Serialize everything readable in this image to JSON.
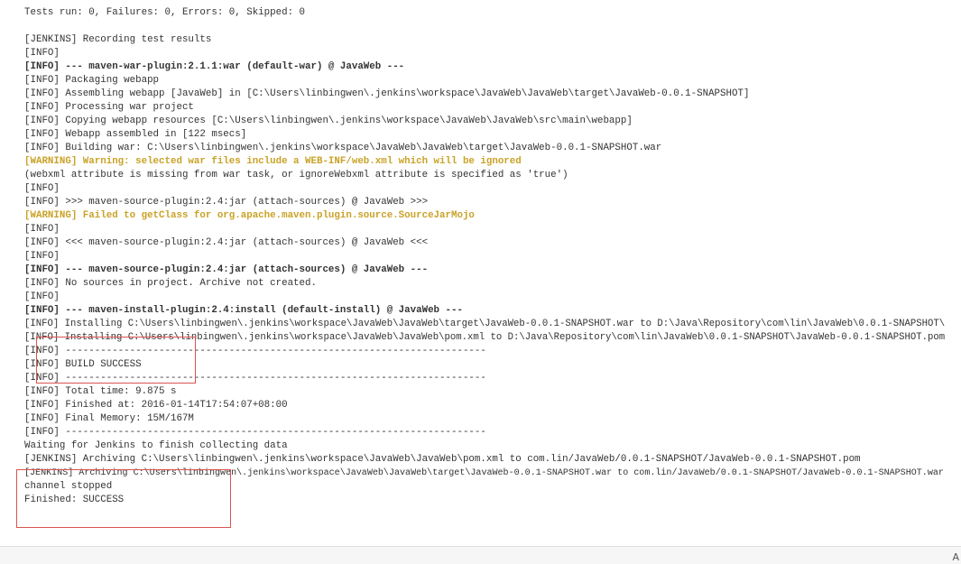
{
  "console": {
    "lines": [
      {
        "text": "Tests run: 0, Failures: 0, Errors: 0, Skipped: 0",
        "style": ""
      },
      {
        "text": "",
        "style": ""
      },
      {
        "text": "[JENKINS] Recording test results",
        "style": ""
      },
      {
        "text": "[INFO]",
        "style": ""
      },
      {
        "text": "[INFO] --- maven-war-plugin:2.1.1:war (default-war) @ JavaWeb ---",
        "style": "bold"
      },
      {
        "text": "[INFO] Packaging webapp",
        "style": ""
      },
      {
        "text": "[INFO] Assembling webapp [JavaWeb] in [C:\\Users\\linbingwen\\.jenkins\\workspace\\JavaWeb\\JavaWeb\\target\\JavaWeb-0.0.1-SNAPSHOT]",
        "style": ""
      },
      {
        "text": "[INFO] Processing war project",
        "style": ""
      },
      {
        "text": "[INFO] Copying webapp resources [C:\\Users\\linbingwen\\.jenkins\\workspace\\JavaWeb\\JavaWeb\\src\\main\\webapp]",
        "style": ""
      },
      {
        "text": "[INFO] Webapp assembled in [122 msecs]",
        "style": ""
      },
      {
        "text": "[INFO] Building war: C:\\Users\\linbingwen\\.jenkins\\workspace\\JavaWeb\\JavaWeb\\target\\JavaWeb-0.0.1-SNAPSHOT.war",
        "style": ""
      },
      {
        "text": "[WARNING] Warning: selected war files include a WEB-INF/web.xml which will be ignored",
        "style": "warn"
      },
      {
        "text": "(webxml attribute is missing from war task, or ignoreWebxml attribute is specified as 'true')",
        "style": ""
      },
      {
        "text": "[INFO]",
        "style": ""
      },
      {
        "text": "[INFO] >>> maven-source-plugin:2.4:jar (attach-sources) @ JavaWeb >>>",
        "style": ""
      },
      {
        "text": "[WARNING] Failed to getClass for org.apache.maven.plugin.source.SourceJarMojo",
        "style": "warn"
      },
      {
        "text": "[INFO]",
        "style": ""
      },
      {
        "text": "[INFO] <<< maven-source-plugin:2.4:jar (attach-sources) @ JavaWeb <<<",
        "style": ""
      },
      {
        "text": "[INFO]",
        "style": ""
      },
      {
        "text": "[INFO] --- maven-source-plugin:2.4:jar (attach-sources) @ JavaWeb ---",
        "style": "bold"
      },
      {
        "text": "[INFO] No sources in project. Archive not created.",
        "style": ""
      },
      {
        "text": "[INFO]",
        "style": ""
      },
      {
        "text": "[INFO] --- maven-install-plugin:2.4:install (default-install) @ JavaWeb ---",
        "style": "bold"
      },
      {
        "text": "[INFO] Installing C:\\Users\\linbingwen\\.jenkins\\workspace\\JavaWeb\\JavaWeb\\target\\JavaWeb-0.0.1-SNAPSHOT.war to D:\\Java\\Repository\\com\\lin\\JavaWeb\\0.0.1-SNAPSHOT\\",
        "style": ""
      },
      {
        "text": "[INFO] Installing C:\\Users\\linbingwen\\.jenkins\\workspace\\JavaWeb\\JavaWeb\\pom.xml to D:\\Java\\Repository\\com\\lin\\JavaWeb\\0.0.1-SNAPSHOT\\JavaWeb-0.0.1-SNAPSHOT.pom",
        "style": ""
      },
      {
        "text": "[INFO] ------------------------------------------------------------------------",
        "style": ""
      },
      {
        "text": "[INFO] BUILD SUCCESS",
        "style": ""
      },
      {
        "text": "[INFO] ------------------------------------------------------------------------",
        "style": ""
      },
      {
        "text": "[INFO] Total time: 9.875 s",
        "style": ""
      },
      {
        "text": "[INFO] Finished at: 2016-01-14T17:54:07+08:00",
        "style": ""
      },
      {
        "text": "[INFO] Final Memory: 15M/167M",
        "style": ""
      },
      {
        "text": "[INFO] ------------------------------------------------------------------------",
        "style": ""
      },
      {
        "text": "Waiting for Jenkins to finish collecting data",
        "style": ""
      },
      {
        "text": "[JENKINS] Archiving C:\\Users\\linbingwen\\.jenkins\\workspace\\JavaWeb\\JavaWeb\\pom.xml to com.lin/JavaWeb/0.0.1-SNAPSHOT/JavaWeb-0.0.1-SNAPSHOT.pom",
        "style": ""
      },
      {
        "text": "[JENKINS] Archiving C:\\Users\\linbingwen\\.jenkins\\workspace\\JavaWeb\\JavaWeb\\target\\JavaWeb-0.0.1-SNAPSHOT.war to com.lin/JavaWeb/0.0.1-SNAPSHOT/JavaWeb-0.0.1-SNAPSHOT.war",
        "style": ""
      },
      {
        "text": "channel stopped",
        "style": ""
      },
      {
        "text": "Finished: SUCCESS",
        "style": ""
      }
    ]
  },
  "colors": {
    "warning": "#c9a227",
    "highlight_box": "#d9534f"
  },
  "footer": {
    "char": "A"
  }
}
